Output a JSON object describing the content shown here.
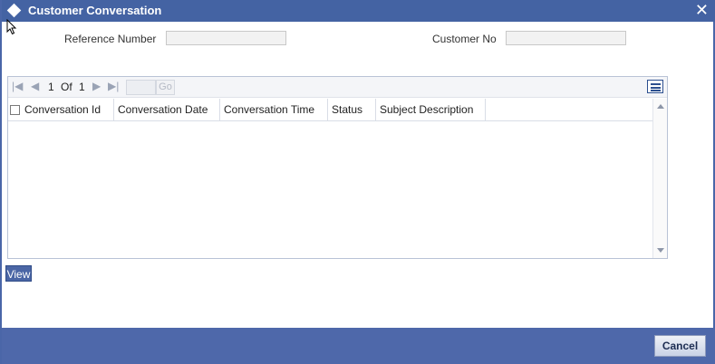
{
  "window": {
    "title": "Customer Conversation",
    "close_glyph": "✕"
  },
  "form": {
    "reference_number_label": "Reference Number",
    "reference_number_value": "",
    "customer_no_label": "Customer No",
    "customer_no_value": ""
  },
  "pager": {
    "current_page": "1",
    "of_label": "Of",
    "total_pages": "1",
    "go_label": "Go",
    "page_input_value": ""
  },
  "table": {
    "columns": [
      "Conversation Id",
      "Conversation Date",
      "Conversation Time",
      "Status",
      "Subject Description"
    ],
    "rows": []
  },
  "actions": {
    "view_label": "View",
    "cancel_label": "Cancel"
  },
  "colors": {
    "titlebar": "#4463a3",
    "footer": "#4e68aa",
    "accent": "#4b66a5"
  },
  "icons": [
    "diamond-icon",
    "close-icon",
    "first-page-icon",
    "prev-page-icon",
    "next-page-icon",
    "last-page-icon",
    "columns-icon",
    "scroll-up-icon",
    "scroll-down-icon"
  ]
}
